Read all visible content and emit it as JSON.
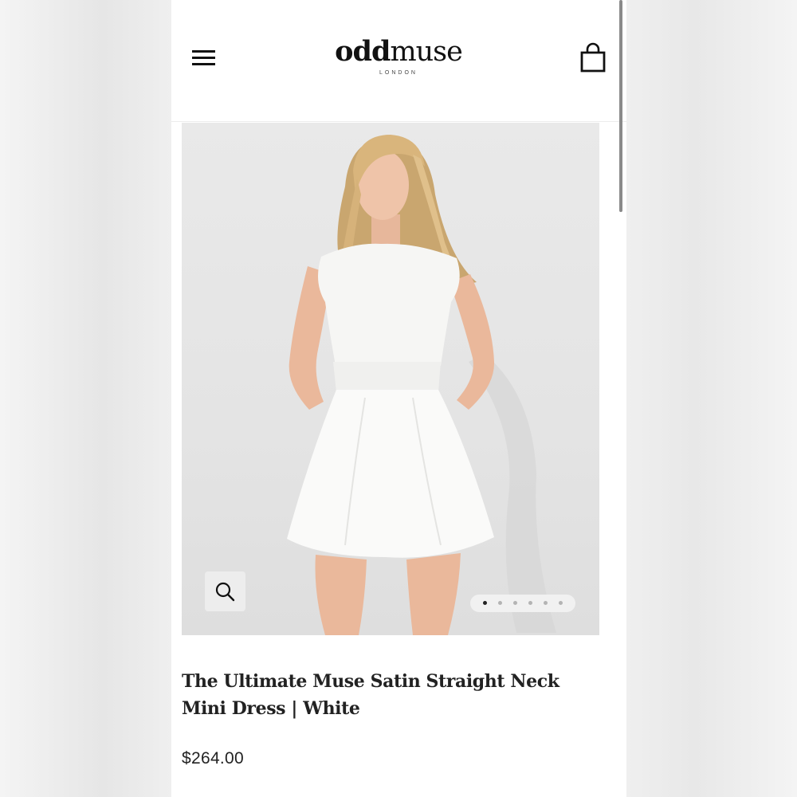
{
  "header": {
    "logo_bold": "odd",
    "logo_regular": "muse",
    "logo_sub": "LONDON",
    "menu_icon": "hamburger-menu-icon",
    "cart_icon": "shopping-bag-icon"
  },
  "gallery": {
    "zoom_icon": "magnifier-icon",
    "slide_count": 6,
    "active_slide": 1
  },
  "product": {
    "title": "The Ultimate Muse Satin Straight Neck Mini Dress | White",
    "price": "$264.00"
  },
  "colors": {
    "text": "#222222",
    "background": "#ffffff",
    "image_bg": "#e6e6e6"
  }
}
